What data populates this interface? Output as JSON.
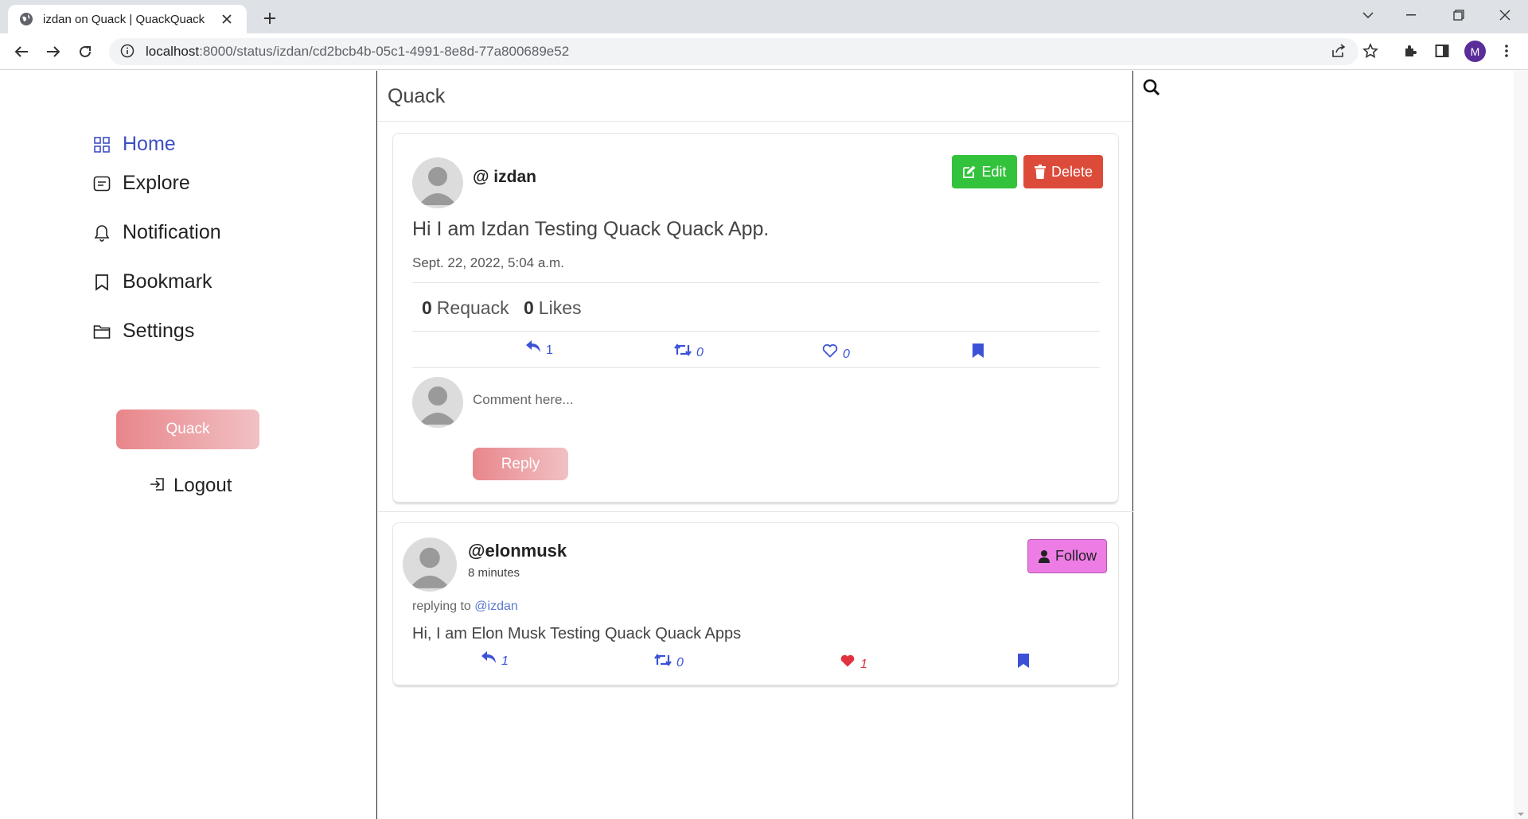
{
  "browser": {
    "tab_title": "izdan on Quack | QuackQuack",
    "url_host": "localhost",
    "url_rest": ":8000/status/izdan/cd2bcb4b-05c1-4991-8e8d-77a800689e52",
    "profile_initial": "M"
  },
  "sidebar": {
    "items": [
      {
        "label": "Home",
        "icon": "grid-icon",
        "active": true
      },
      {
        "label": "Explore",
        "icon": "card-text-icon"
      },
      {
        "label": "Notification",
        "icon": "bell-icon"
      },
      {
        "label": "Bookmark",
        "icon": "bookmark-icon"
      },
      {
        "label": "Settings",
        "icon": "folder-icon"
      }
    ],
    "quack_button": "Quack",
    "logout_label": "Logout"
  },
  "feed": {
    "header": "Quack",
    "post": {
      "handle": "@ izdan",
      "edit_label": "Edit",
      "delete_label": "Delete",
      "text": "Hi I am Izdan Testing Quack Quack App.",
      "date": "Sept. 22, 2022, 5:04 a.m.",
      "requack_count": "0",
      "requack_label": "Requack",
      "likes_count": "0",
      "likes_label": "Likes",
      "reply_count": "1",
      "retweet_count": "0",
      "heart_count": "0",
      "comment_placeholder": "Comment here...",
      "reply_button": "Reply"
    },
    "reply": {
      "handle": "@elonmusk",
      "time": "8 minutes",
      "follow_label": "Follow",
      "replying_prefix": "replying to",
      "replying_mention": "@izdan",
      "text": "Hi, I am Elon Musk Testing Quack Quack Apps",
      "reply_count": "1",
      "retweet_count": "0",
      "heart_count": "1"
    }
  },
  "colors": {
    "accent": "#3d4fc4",
    "edit_green": "#33c23b",
    "delete_red": "#dc4b3a",
    "follow_pink": "#ee7ce5",
    "quack_gradient_start": "#e8868a",
    "heart_red": "#e0333f"
  }
}
